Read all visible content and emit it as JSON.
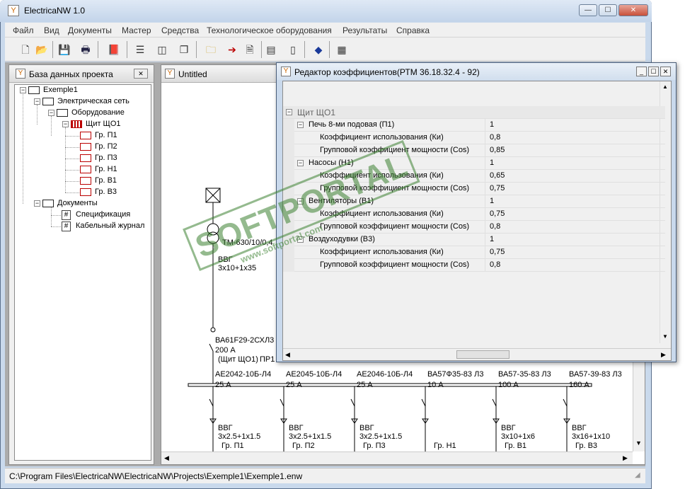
{
  "window": {
    "title": "ElectricaNW 1.0",
    "btn_min": "—",
    "btn_max": "☐",
    "btn_close": "✕"
  },
  "menu": [
    "Файл",
    "Вид",
    "Документы",
    "Мастер",
    "Средства",
    "Технологическое оборудования",
    "Результаты",
    "Справка"
  ],
  "sidebar": {
    "title": "База данных проекта",
    "tree": {
      "root": "Exemple1",
      "network": "Электрическая сеть",
      "equipment": "Оборудование",
      "panel": "Щит ЩО1",
      "groups": [
        "Гр. П1",
        "Гр. П2",
        "Гр. П3",
        "Гр. Н1",
        "Гр. В1",
        "Гр. В3"
      ],
      "documents": "Документы",
      "docs": [
        "Спецификация",
        "Кабельный журнал"
      ]
    }
  },
  "drawing": {
    "title": "Untitled",
    "transformer": "ТМ-630/10/0,4",
    "cable_main_1": "ВВГ",
    "cable_main_2": "3x10+1x35",
    "main_breaker": "ВА61F29-2СХЛ3",
    "main_current": "200 А",
    "panel_label": "(Щит ЩО1)",
    "panel_label2": "ПР1",
    "branches": [
      {
        "breaker": "АЕ2042-10Б-Л4",
        "current": "25 А",
        "cable": "ВВГ",
        "section": "3x2.5+1x1.5",
        "group": "Гр. П1"
      },
      {
        "breaker": "АЕ2045-10Б-Л4",
        "current": "25 А",
        "cable": "ВВГ",
        "section": "3x2.5+1x1.5",
        "group": "Гр. П2"
      },
      {
        "breaker": "АЕ2046-10Б-Л4",
        "current": "25 А",
        "cable": "ВВГ",
        "section": "3x2.5+1x1.5",
        "group": "Гр. П3"
      },
      {
        "breaker": "ВА57Ф35-83 Л3",
        "current": "10 А",
        "cable": "",
        "section": "",
        "group": "Гр. Н1"
      },
      {
        "breaker": "ВА57-35-83 Л3",
        "current": "100 А",
        "cable": "ВВГ",
        "section": "3x10+1x6",
        "group": "Гр. В1"
      },
      {
        "breaker": "ВА57-39-83 Л3",
        "current": "160 А",
        "cable": "ВВГ",
        "section": "3x16+1x10",
        "group": "Гр. В3"
      }
    ]
  },
  "dialog": {
    "title": "Редактор коэффициентов(РТМ 36.18.32.4 - 92)",
    "rows": [
      {
        "name": "Щит ЩО1",
        "value": ""
      },
      {
        "name": "Печь 8-ми подовая (П1)",
        "value": "1"
      },
      {
        "name": "Коэффициент использования (Ки)",
        "value": "0,8"
      },
      {
        "name": "Групповой коэффициент мощности (Cos)",
        "value": "0,85"
      },
      {
        "name": "Насосы (Н1)",
        "value": "1"
      },
      {
        "name": "Коэффициент использования (Ки)",
        "value": "0,65"
      },
      {
        "name": "Групповой коэффициент мощности (Cos)",
        "value": "0,75"
      },
      {
        "name": "Вентиляторы (В1)",
        "value": "1"
      },
      {
        "name": "Коэффициент использования (Ки)",
        "value": "0,75"
      },
      {
        "name": "Групповой коэффициент мощности (Cos)",
        "value": "0,8"
      },
      {
        "name": "Воздуходувки (В3)",
        "value": "1"
      },
      {
        "name": "Коэффициент использования (Ки)",
        "value": "0,75"
      },
      {
        "name": "Групповой коэффициент мощности (Cos)",
        "value": "0,8"
      }
    ]
  },
  "status": {
    "path": "C:\\Program Files\\ElectricaNW\\ElectricaNW\\Projects\\Exemple1\\Exemple1.enw"
  },
  "watermark": {
    "line1": "SOFTPORTAL",
    "line2": "www.softportal.com"
  }
}
